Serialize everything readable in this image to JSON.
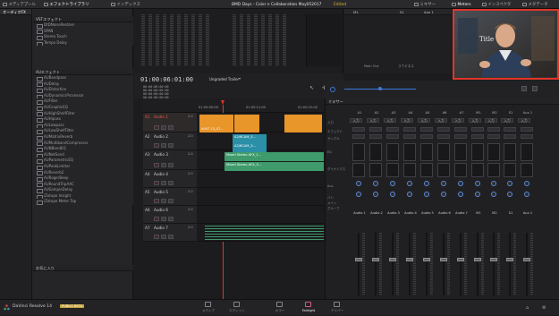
{
  "topbar": {
    "media_pool": "メディアプール",
    "effects_library": "エフェクトライブラリ",
    "index": "インデックス",
    "project_title": "BMD Days - Color n Collaboration May052017",
    "edited_badge": "Edited",
    "mixer": "ミキサー",
    "meters": "Meters",
    "inspector": "インスペクタ",
    "metadata": "メタデータ"
  },
  "effects_panel": {
    "audio_fx_header": "オーディオFX",
    "vst_header": "VSTエフェクト",
    "vst_items": [
      "DtDNoiseRestore",
      "SPAN",
      "Stereo Touch",
      "Tempo Delay"
    ],
    "au_header": "AUエフェクト",
    "au_items": [
      "AUBandpass",
      "AUDelay",
      "AUDistortion",
      "AUDynamicsProcessor",
      "AUFilter",
      "AUGraphicEQ",
      "AUHighShelfFilter",
      "AUHipass",
      "AULowpass",
      "AULowShelfFilter",
      "AUMatrixReverb",
      "AUMultibandCompressor",
      "AUNBandEQ",
      "AUNetSend",
      "AUParametricEQ",
      "AUPeakLimiter",
      "AUReverb2",
      "AURogerBeep",
      "AURoundTripAAC",
      "AUSampleDelay",
      "iZotope Insight",
      "iZotope Meter Tap"
    ],
    "favorites_header": "お気に入り"
  },
  "meters_panel": {
    "channels": [
      "M1",
      "S1",
      "Aux 1"
    ],
    "bus_label": "Main Out",
    "bus_sub": "ラウドネス",
    "sub_label": "S1"
  },
  "viewer": {
    "timecode_main": "01:00:06:01:00",
    "timeline_name": "Ungraded Trailer",
    "slate_text": "Title"
  },
  "timeline": {
    "tc_rows": [
      "00:00:00:00:00",
      "00:00:00:00:00",
      "00:00:00:00:00",
      "00:00:00:00:00"
    ],
    "ruler": [
      "01:00:00:00",
      "01:00:11:00",
      "01:00:22:00"
    ],
    "tracks": [
      {
        "id": "A1",
        "name": "Audio 1",
        "num": "2.0"
      },
      {
        "id": "A2",
        "name": "Audio 2",
        "num": "2.0"
      },
      {
        "id": "A3",
        "name": "Audio 3",
        "num": "2.0"
      },
      {
        "id": "A4",
        "name": "Audio 4",
        "num": "2.0"
      },
      {
        "id": "A5",
        "name": "Audio 5",
        "num": "2.0"
      },
      {
        "id": "A6",
        "name": "Audio 6",
        "num": "2.0"
      },
      {
        "id": "A7",
        "name": "Audio 7",
        "num": "2.0"
      }
    ],
    "clips": {
      "a1_clip": "A047 13_07...",
      "a2_clip_1": "A2/BCAM_3...",
      "a2_clip_2": "A2/BCAM_3...",
      "a3_clip_1": "Mixed Stereo AFX_1...",
      "a3_clip_2": "Mixed Stereo AFX_3..."
    }
  },
  "mixer": {
    "header": "ミキサー",
    "columns": [
      "A1",
      "A2",
      "A3",
      "A4",
      "A5",
      "A6",
      "A7",
      "M1",
      "M2",
      "S1",
      "Aux 1"
    ],
    "row_labels": [
      "入力",
      "エフェクト",
      "サンプル",
      "EQ",
      "ダイナミクス",
      "Aux",
      "バン",
      "メイン",
      "グループ"
    ],
    "input_label": "入力",
    "channel_names": [
      "Audio 1",
      "Audio 2",
      "Audio 3",
      "Audio 4",
      "Audio 5",
      "Audio 6",
      "Audio 7",
      "M1",
      "M2",
      "S1",
      "Aux 1"
    ]
  },
  "bottombar": {
    "app_name": "DaVinci Resolve 14",
    "beta_badge": "PUBLIC BETA",
    "tabs": [
      "メディア",
      "エディット",
      "カラー",
      "Fairlight",
      "デリバー"
    ],
    "active_tab": "Fairlight"
  },
  "colors": {
    "accent_blue": "#3d7bdc",
    "clip_orange": "#e8952a",
    "clip_teal": "#2b8fa8",
    "clip_green": "#3f9b6b",
    "highlight_red": "#e0352b",
    "fairlight_pink": "#d95a8a"
  }
}
